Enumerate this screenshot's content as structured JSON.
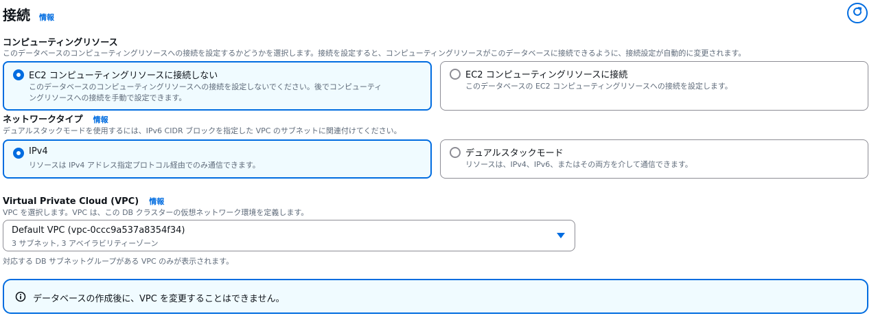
{
  "header": {
    "title": "接続",
    "info_label": "情報",
    "refresh_icon": "refresh-icon"
  },
  "compute": {
    "title": "コンピューティングリソース",
    "description": "このデータベースのコンピューティングリソースへの接続を設定するかどうかを選択します。接続を設定すると、コンピューティングリソースがこのデータベースに接続できるように、接続設定が自動的に変更されます。",
    "options": [
      {
        "label": "EC2 コンピューティングリソースに接続しない",
        "description_line1": "このデータベースのコンピューティングリソースへの接続を設定しないでください。後でコンピューティ",
        "description_line2": "ングリソースへの接続を手動で設定できます。",
        "selected": true
      },
      {
        "label": "EC2 コンピューティングリソースに接続",
        "description": "このデータベースの EC2 コンピューティングリソースへの接続を設定します。",
        "selected": false
      }
    ]
  },
  "network": {
    "title": "ネットワークタイプ",
    "info_label": "情報",
    "description": "デュアルスタックモードを使用するには、IPv6 CIDR ブロックを指定した VPC のサブネットに関連付けてください。",
    "options": [
      {
        "label": "IPv4",
        "description": "リソースは IPv4 アドレス指定プロトコル経由でのみ通信できます。",
        "selected": true
      },
      {
        "label": "デュアルスタックモード",
        "description": "リソースは、IPv4、IPv6、またはその両方を介して通信できます。",
        "selected": false
      }
    ]
  },
  "vpc": {
    "title": "Virtual Private Cloud (VPC)",
    "info_label": "情報",
    "description": "VPC を選択します。VPC は、この DB クラスターの仮想ネットワーク環境を定義します。",
    "selected_value": "Default VPC (vpc-0ccc9a537a8354f34)",
    "selected_subtext": "3 サブネット, 3 アベイラビリティーゾーン",
    "hint": "対応する DB サブネットグループがある VPC のみが表示されます。"
  },
  "alert": {
    "text": "データベースの作成後に、VPC を変更することはできません。",
    "icon": "info-icon"
  },
  "colors": {
    "accent": "#006ce0",
    "selected_bg": "#f0fbff",
    "border": "#8c8c94",
    "muted_text": "#5f6b7a"
  }
}
